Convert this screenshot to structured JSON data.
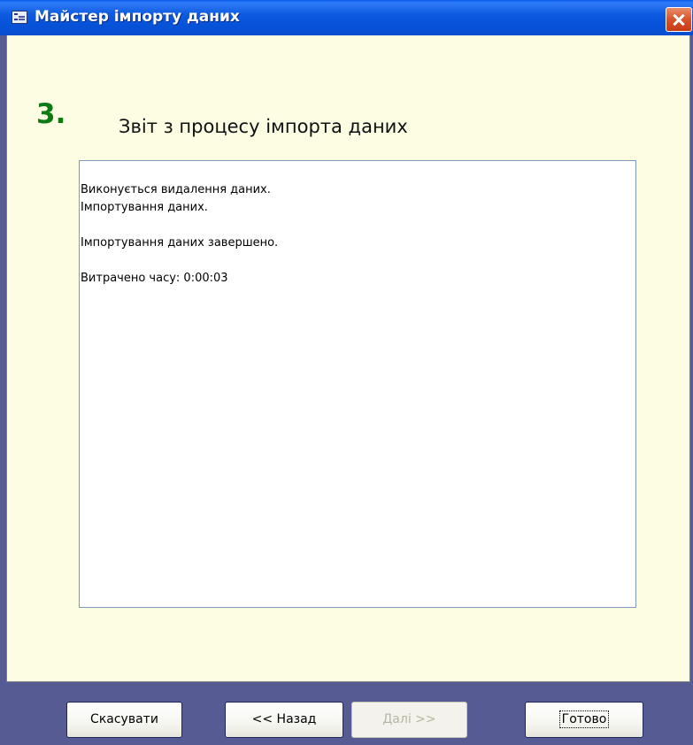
{
  "window": {
    "title": "Майстер імпорту даних",
    "title_icon": "form-window-icon",
    "close_icon": "close-icon",
    "accent_color": "#0a5ae8",
    "close_color": "#d8522a"
  },
  "step": {
    "number": "3.",
    "title": "Звіт з процесу імпорта даних",
    "number_color": "#0d7a13"
  },
  "report": {
    "lines": [
      "Виконується видалення даних.",
      "Імпортування даних.",
      "",
      "Імпортування даних завершено.",
      "",
      "Витрачено часу: 0:00:03"
    ]
  },
  "buttons": {
    "cancel_label": "Скасувати",
    "back_label": "<< Назад",
    "next_label": "Далі >>",
    "finish_label": "Готово"
  },
  "colors": {
    "content_background": "#fdfde4",
    "button_bar_background": "#575b93"
  }
}
